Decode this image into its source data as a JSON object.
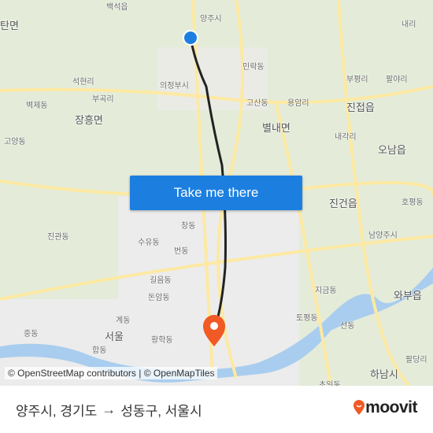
{
  "map": {
    "labels": {
      "l1": "백석읍",
      "l2": "양주시",
      "l3": "탄면",
      "l4": "석현리",
      "l5": "의정부시",
      "l6": "민락동",
      "l7": "고산동",
      "l8": "용암리",
      "l9": "부평리",
      "l10": "팔야리",
      "l11": "진접읍",
      "l12": "벽제동",
      "l13": "부곡리",
      "l14": "장흥면",
      "l15": "별내면",
      "l16": "내각리",
      "l17": "고양동",
      "l18": "오남읍",
      "l19": "진건읍",
      "l20": "호평동",
      "l21": "진관동",
      "l22": "창동",
      "l23": "수유동",
      "l24": "번동",
      "l25": "남양주시",
      "l26": "길음동",
      "l27": "돈암동",
      "l28": "지금동",
      "l29": "와부읍",
      "l30": "계동",
      "l31": "서울",
      "l32": "황학동",
      "l33": "토평동",
      "l34": "중동",
      "l35": "합동",
      "l36": "선동",
      "l37": "하남시",
      "l38": "내리",
      "l39": "팔당리",
      "l40": "초일동"
    },
    "colors": {
      "route": "#222222",
      "origin": "#1c7fe0",
      "destination": "#f15a24",
      "water": "#a9cdee",
      "road": "#fde9a3"
    }
  },
  "cta_label": "Take me there",
  "attribution": "© OpenStreetMap contributors | © OpenMapTiles",
  "footer": {
    "origin": "양주시, 경기도",
    "arrow": "→",
    "destination": "성동구, 서울시",
    "brand": "moovit"
  }
}
